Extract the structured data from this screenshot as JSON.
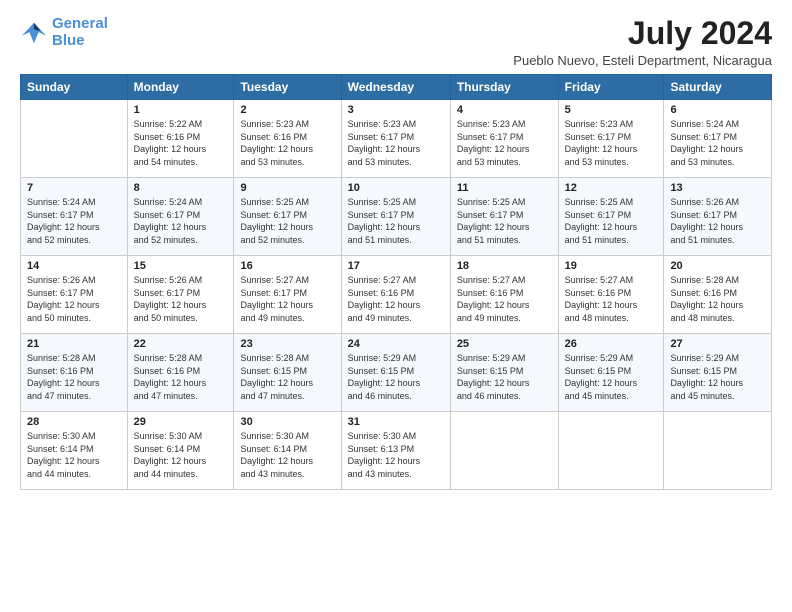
{
  "logo": {
    "line1": "General",
    "line2": "Blue"
  },
  "title": {
    "month_year": "July 2024",
    "location": "Pueblo Nuevo, Esteli Department, Nicaragua"
  },
  "weekdays": [
    "Sunday",
    "Monday",
    "Tuesday",
    "Wednesday",
    "Thursday",
    "Friday",
    "Saturday"
  ],
  "weeks": [
    [
      {
        "num": "",
        "detail": ""
      },
      {
        "num": "1",
        "detail": "Sunrise: 5:22 AM\nSunset: 6:16 PM\nDaylight: 12 hours\nand 54 minutes."
      },
      {
        "num": "2",
        "detail": "Sunrise: 5:23 AM\nSunset: 6:16 PM\nDaylight: 12 hours\nand 53 minutes."
      },
      {
        "num": "3",
        "detail": "Sunrise: 5:23 AM\nSunset: 6:17 PM\nDaylight: 12 hours\nand 53 minutes."
      },
      {
        "num": "4",
        "detail": "Sunrise: 5:23 AM\nSunset: 6:17 PM\nDaylight: 12 hours\nand 53 minutes."
      },
      {
        "num": "5",
        "detail": "Sunrise: 5:23 AM\nSunset: 6:17 PM\nDaylight: 12 hours\nand 53 minutes."
      },
      {
        "num": "6",
        "detail": "Sunrise: 5:24 AM\nSunset: 6:17 PM\nDaylight: 12 hours\nand 53 minutes."
      }
    ],
    [
      {
        "num": "7",
        "detail": "Sunrise: 5:24 AM\nSunset: 6:17 PM\nDaylight: 12 hours\nand 52 minutes."
      },
      {
        "num": "8",
        "detail": "Sunrise: 5:24 AM\nSunset: 6:17 PM\nDaylight: 12 hours\nand 52 minutes."
      },
      {
        "num": "9",
        "detail": "Sunrise: 5:25 AM\nSunset: 6:17 PM\nDaylight: 12 hours\nand 52 minutes."
      },
      {
        "num": "10",
        "detail": "Sunrise: 5:25 AM\nSunset: 6:17 PM\nDaylight: 12 hours\nand 51 minutes."
      },
      {
        "num": "11",
        "detail": "Sunrise: 5:25 AM\nSunset: 6:17 PM\nDaylight: 12 hours\nand 51 minutes."
      },
      {
        "num": "12",
        "detail": "Sunrise: 5:25 AM\nSunset: 6:17 PM\nDaylight: 12 hours\nand 51 minutes."
      },
      {
        "num": "13",
        "detail": "Sunrise: 5:26 AM\nSunset: 6:17 PM\nDaylight: 12 hours\nand 51 minutes."
      }
    ],
    [
      {
        "num": "14",
        "detail": "Sunrise: 5:26 AM\nSunset: 6:17 PM\nDaylight: 12 hours\nand 50 minutes."
      },
      {
        "num": "15",
        "detail": "Sunrise: 5:26 AM\nSunset: 6:17 PM\nDaylight: 12 hours\nand 50 minutes."
      },
      {
        "num": "16",
        "detail": "Sunrise: 5:27 AM\nSunset: 6:17 PM\nDaylight: 12 hours\nand 49 minutes."
      },
      {
        "num": "17",
        "detail": "Sunrise: 5:27 AM\nSunset: 6:16 PM\nDaylight: 12 hours\nand 49 minutes."
      },
      {
        "num": "18",
        "detail": "Sunrise: 5:27 AM\nSunset: 6:16 PM\nDaylight: 12 hours\nand 49 minutes."
      },
      {
        "num": "19",
        "detail": "Sunrise: 5:27 AM\nSunset: 6:16 PM\nDaylight: 12 hours\nand 48 minutes."
      },
      {
        "num": "20",
        "detail": "Sunrise: 5:28 AM\nSunset: 6:16 PM\nDaylight: 12 hours\nand 48 minutes."
      }
    ],
    [
      {
        "num": "21",
        "detail": "Sunrise: 5:28 AM\nSunset: 6:16 PM\nDaylight: 12 hours\nand 47 minutes."
      },
      {
        "num": "22",
        "detail": "Sunrise: 5:28 AM\nSunset: 6:16 PM\nDaylight: 12 hours\nand 47 minutes."
      },
      {
        "num": "23",
        "detail": "Sunrise: 5:28 AM\nSunset: 6:15 PM\nDaylight: 12 hours\nand 47 minutes."
      },
      {
        "num": "24",
        "detail": "Sunrise: 5:29 AM\nSunset: 6:15 PM\nDaylight: 12 hours\nand 46 minutes."
      },
      {
        "num": "25",
        "detail": "Sunrise: 5:29 AM\nSunset: 6:15 PM\nDaylight: 12 hours\nand 46 minutes."
      },
      {
        "num": "26",
        "detail": "Sunrise: 5:29 AM\nSunset: 6:15 PM\nDaylight: 12 hours\nand 45 minutes."
      },
      {
        "num": "27",
        "detail": "Sunrise: 5:29 AM\nSunset: 6:15 PM\nDaylight: 12 hours\nand 45 minutes."
      }
    ],
    [
      {
        "num": "28",
        "detail": "Sunrise: 5:30 AM\nSunset: 6:14 PM\nDaylight: 12 hours\nand 44 minutes."
      },
      {
        "num": "29",
        "detail": "Sunrise: 5:30 AM\nSunset: 6:14 PM\nDaylight: 12 hours\nand 44 minutes."
      },
      {
        "num": "30",
        "detail": "Sunrise: 5:30 AM\nSunset: 6:14 PM\nDaylight: 12 hours\nand 43 minutes."
      },
      {
        "num": "31",
        "detail": "Sunrise: 5:30 AM\nSunset: 6:13 PM\nDaylight: 12 hours\nand 43 minutes."
      },
      {
        "num": "",
        "detail": ""
      },
      {
        "num": "",
        "detail": ""
      },
      {
        "num": "",
        "detail": ""
      }
    ]
  ]
}
